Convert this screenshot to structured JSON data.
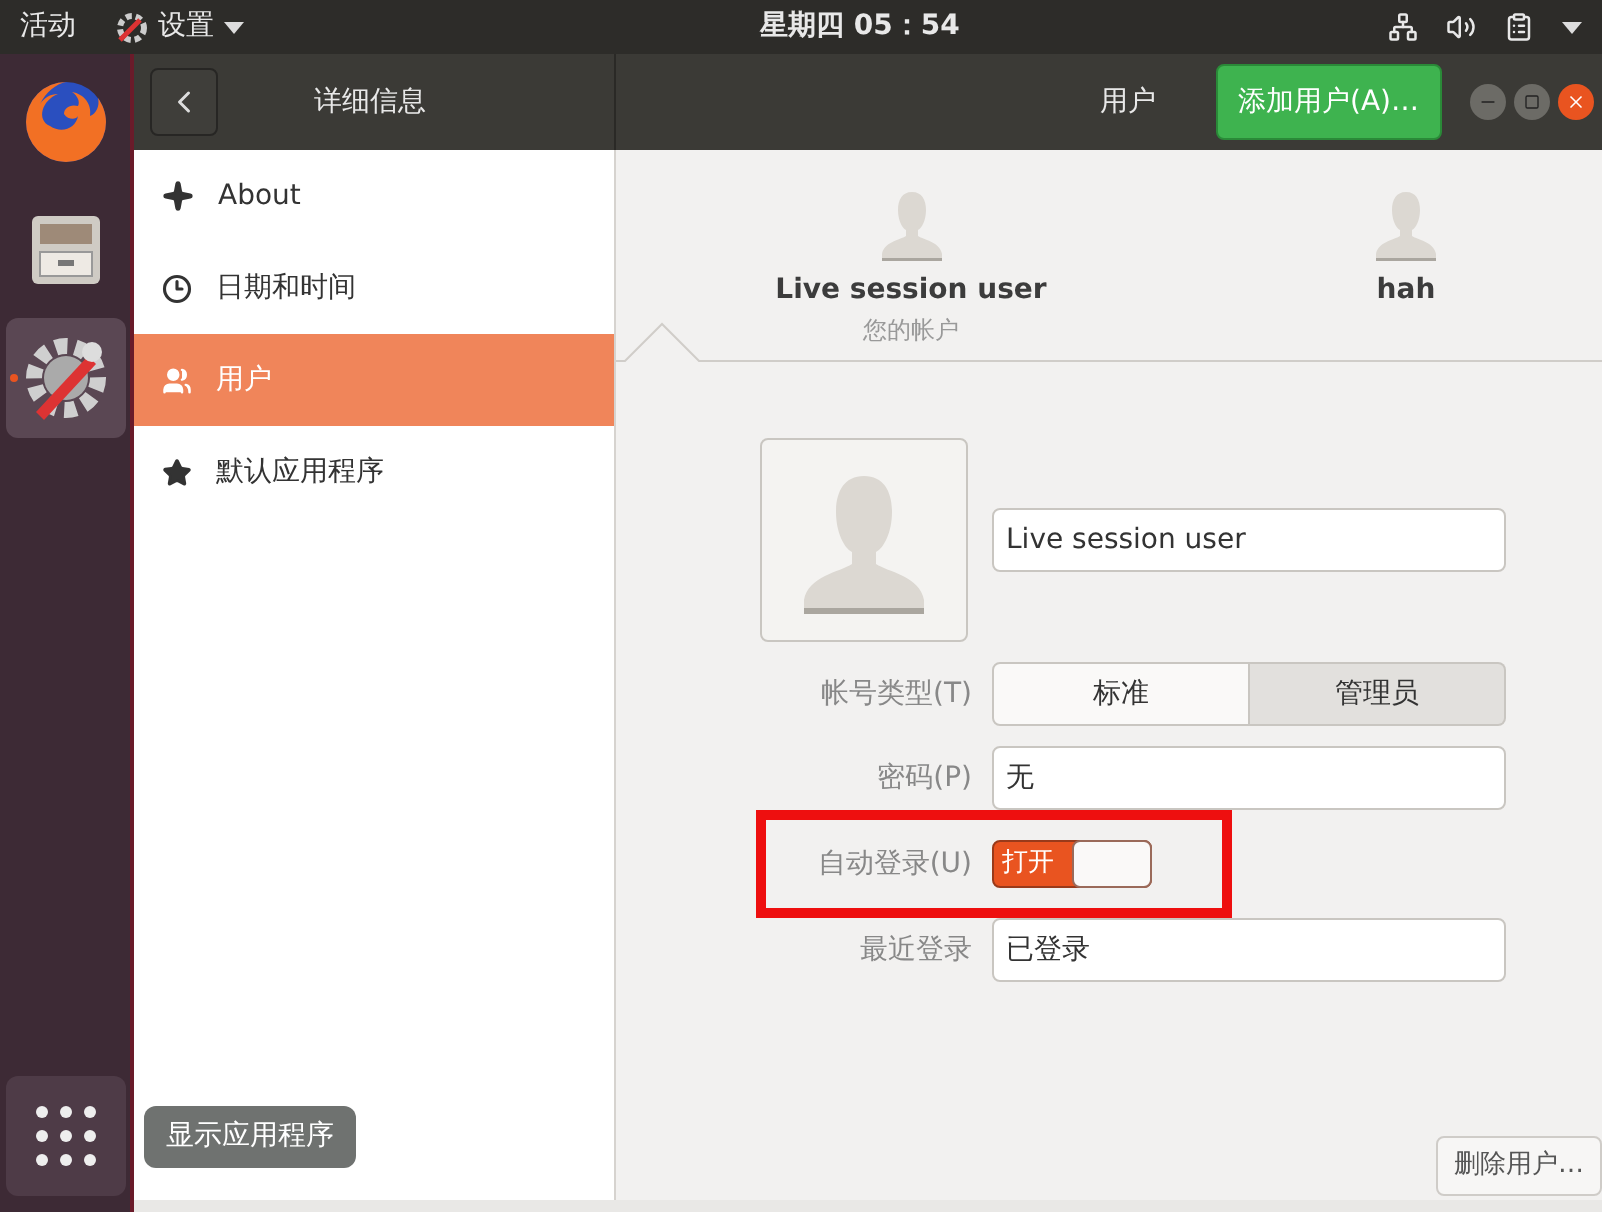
{
  "top_bar": {
    "activities": "活动",
    "app_menu": "设置",
    "clock": "星期四 05：54"
  },
  "dock": {
    "items": [
      {
        "kind": "browser",
        "running": false
      },
      {
        "kind": "files",
        "running": false
      },
      {
        "kind": "settings",
        "running": true
      }
    ],
    "show_apps_tooltip": "显示应用程序"
  },
  "header": {
    "sidebar_title": "详细信息",
    "page_title": "用户",
    "add_button": "添加用户(A)…"
  },
  "sidebar": {
    "items": [
      {
        "label": "About",
        "kind": "sparkle",
        "selected": false
      },
      {
        "label": "日期和时间",
        "kind": "clock",
        "selected": false
      },
      {
        "label": "用户",
        "kind": "users",
        "selected": true
      },
      {
        "label": "默认应用程序",
        "kind": "star",
        "selected": false
      }
    ]
  },
  "users": [
    {
      "name": "Live session user",
      "subtitle": "您的帐户",
      "selected": true
    },
    {
      "name": "hah",
      "selected": false
    }
  ],
  "form": {
    "name_value": "Live session user",
    "account_type_label": "帐号类型(T)",
    "account_types": [
      {
        "label": "标准",
        "selected": false
      },
      {
        "label": "管理员",
        "selected": true
      }
    ],
    "password_label": "密码(P)",
    "password_value": "无",
    "autologin_label": "自动登录(U)",
    "autologin_on": true,
    "autologin_on_label": "打开",
    "autologin_highlighted": true,
    "last_login_label": "最近登录",
    "last_login_value": "已登录"
  },
  "delete_button": "删除用户…"
}
